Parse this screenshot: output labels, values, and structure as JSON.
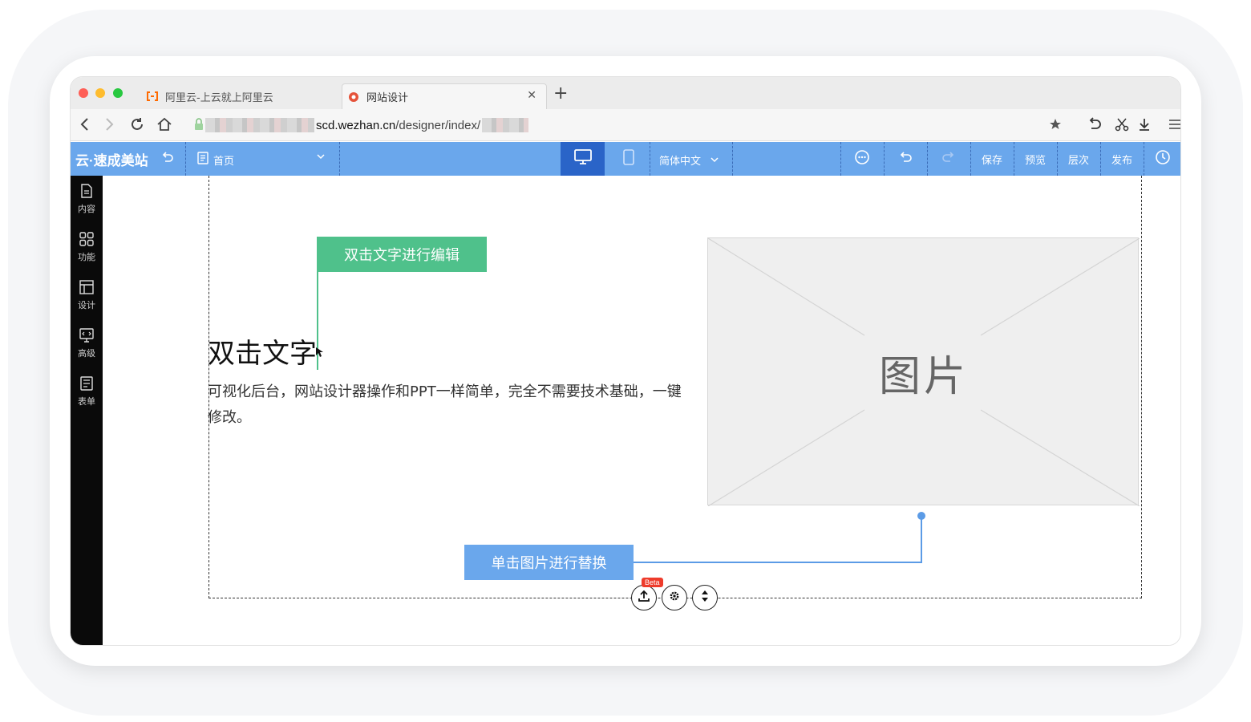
{
  "browser": {
    "tabs": [
      {
        "label": "阿里云-上云就上阿里云",
        "active": false
      },
      {
        "label": "网站设计",
        "active": true
      }
    ],
    "url": {
      "host": "scd.wezhan.cn",
      "path": "/designer/index/"
    }
  },
  "toolbar": {
    "brand": "云·速成美站",
    "page_select": "首页",
    "language": "简体中文",
    "save_label": "保存",
    "preview_label": "预览",
    "layers_label": "层次",
    "publish_label": "发布"
  },
  "sidebar": {
    "items": [
      {
        "label": "内容",
        "icon": "document-icon"
      },
      {
        "label": "功能",
        "icon": "grid-icon"
      },
      {
        "label": "设计",
        "icon": "layout-icon"
      },
      {
        "label": "高级",
        "icon": "code-icon"
      },
      {
        "label": "表单",
        "icon": "form-icon"
      }
    ]
  },
  "canvas": {
    "heading": "双击文字",
    "body": "可视化后台，网站设计器操作和PPT一样简单，完全不需要技术基础，一键修改。",
    "image_label": "图片",
    "tip_edit_text": "双击文字进行编辑",
    "tip_replace_image": "单击图片进行替换",
    "beta_badge": "Beta"
  },
  "colors": {
    "toolbar_bg": "#6aa7ec",
    "active_device": "#2a64c8",
    "tip_green": "#4fc18b",
    "tip_blue": "#6aa7ec",
    "sidebar_bg": "#0a0a0a"
  }
}
